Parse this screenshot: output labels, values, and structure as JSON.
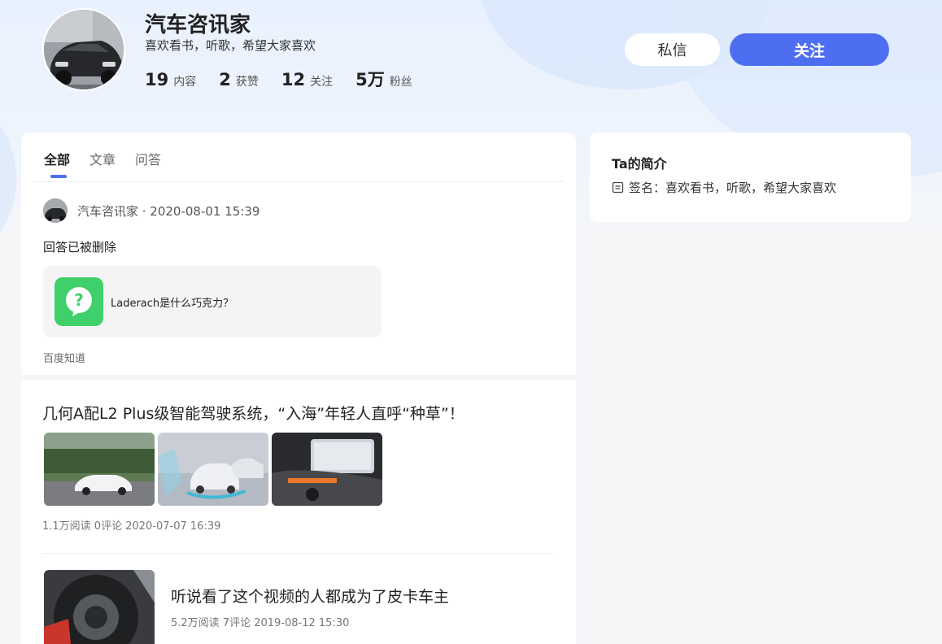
{
  "profile": {
    "name": "汽车咨讯家",
    "bio": "喜欢看书，听歌，希望大家喜欢",
    "stats": [
      {
        "num": "19",
        "label": "内容"
      },
      {
        "num": "2",
        "label": "获赞"
      },
      {
        "num": "12",
        "label": "关注"
      },
      {
        "num": "5万",
        "label": "粉丝"
      }
    ],
    "message_label": "私信",
    "follow_label": "关注"
  },
  "tabs": [
    {
      "label": "全部",
      "active": true
    },
    {
      "label": "文章",
      "active": false
    },
    {
      "label": "问答",
      "active": false
    }
  ],
  "feed": {
    "answer": {
      "author_meta": "汽车咨讯家 · 2020-08-01 15:39",
      "status": "回答已被删除",
      "question": "Laderach是什么巧克力？",
      "source": "百度知道"
    },
    "article1": {
      "title": "几何A配L2 Plus级智能驾驶系统，“入海”年轻人直呼“种草”！",
      "meta": "1.1万阅读  0评论  2020-07-07 16:39"
    },
    "article2": {
      "title": "听说看了这个视频的人都成为了皮卡车主",
      "meta": "5.2万阅读  7评论  2019-08-12 15:30"
    }
  },
  "intro": {
    "title": "Ta的简介",
    "signature": "签名：喜欢看书，听歌，希望大家喜欢"
  },
  "colors": {
    "accent": "#4e6ef2",
    "question_icon_bg": "#3fd06a"
  }
}
